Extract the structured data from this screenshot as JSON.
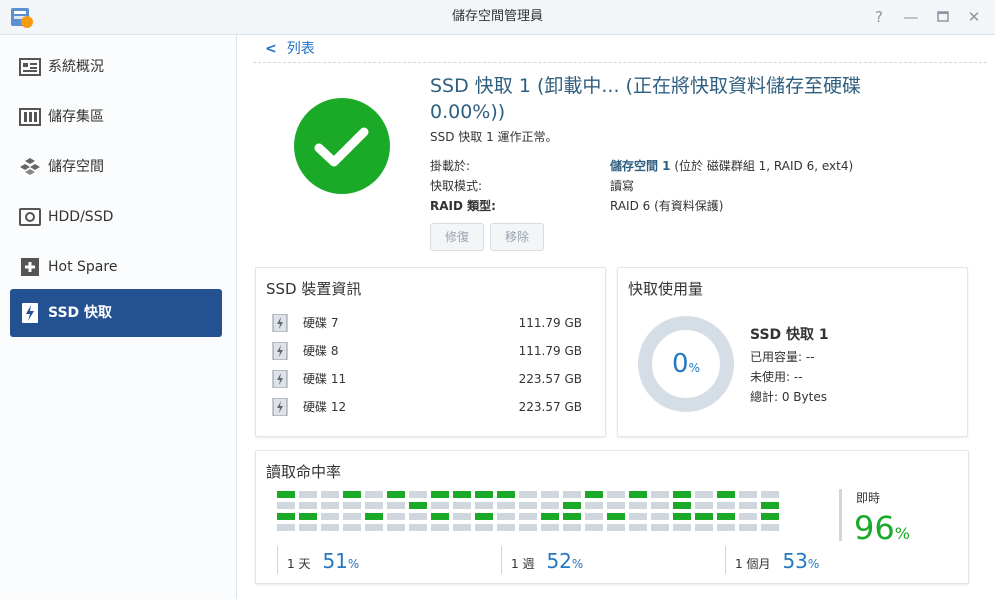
{
  "window": {
    "title": "儲存空間管理員"
  },
  "sidebar": {
    "items": [
      {
        "label": "系統概況",
        "icon": "overview-icon",
        "active": false
      },
      {
        "label": "儲存集區",
        "icon": "storage-pool-icon",
        "active": false
      },
      {
        "label": "儲存空間",
        "icon": "volume-icon",
        "active": false
      },
      {
        "label": "HDD/SSD",
        "icon": "hdd-icon",
        "active": false
      },
      {
        "label": "Hot Spare",
        "icon": "hot-spare-icon",
        "active": false
      },
      {
        "label": "SSD 快取",
        "icon": "ssd-cache-icon",
        "active": true
      }
    ]
  },
  "main": {
    "back_label": "列表",
    "title": "SSD 快取 1 (卸載中... (正在將快取資料儲存至硬碟 0.00%))",
    "subtitle": "SSD 快取 1 運作正常。",
    "details": [
      {
        "label": "掛載於:",
        "value_bold": "儲存空間 1",
        "value_rest": " (位於 磁碟群組 1, RAID 6, ext4)"
      },
      {
        "label": "快取模式:",
        "value_bold": "",
        "value_rest": "讀寫"
      },
      {
        "label": "RAID 類型:",
        "value_bold": "",
        "value_rest": "RAID 6 (有資料保護)"
      }
    ],
    "buttons": {
      "repair": "修復",
      "remove": "移除"
    },
    "ssd_info": {
      "title": "SSD 裝置資訊",
      "disks": [
        {
          "name": "硬碟 7",
          "size": "111.79 GB"
        },
        {
          "name": "硬碟 8",
          "size": "111.79 GB"
        },
        {
          "name": "硬碟 11",
          "size": "223.57 GB"
        },
        {
          "name": "硬碟 12",
          "size": "223.57 GB"
        }
      ]
    },
    "cache_usage": {
      "title": "快取使用量",
      "percent": "0",
      "percent_unit": "%",
      "name": "SSD 快取 1",
      "used": "已用容量: --",
      "unused": "未使用: --",
      "total": "總計: 0 Bytes"
    },
    "hit_rate": {
      "title": "讀取命中率",
      "day_label": "1 天",
      "day_value": "51",
      "week_label": "1 週",
      "week_value": "52",
      "month_label": "1 個月",
      "month_value": "53",
      "unit": "%",
      "realtime_label": "即時",
      "realtime_value": "96",
      "colors": {
        "hit": "#1aaa28",
        "miss": "#cfd6de"
      },
      "grid": [
        "GBBGBGBGGGGBBBGBGBGBGBB",
        "BBBBBBGBBBBBBGBBBBGBBBG",
        "GGBBGBBGBGBBGGBGBBGGGBG",
        "BBBBBBBBBBBBBBBBBBBBBBB"
      ]
    }
  },
  "colors": {
    "accent": "#235192",
    "ok": "#1aaa28",
    "link": "#1f6fc4",
    "title": "#2f5f80"
  }
}
